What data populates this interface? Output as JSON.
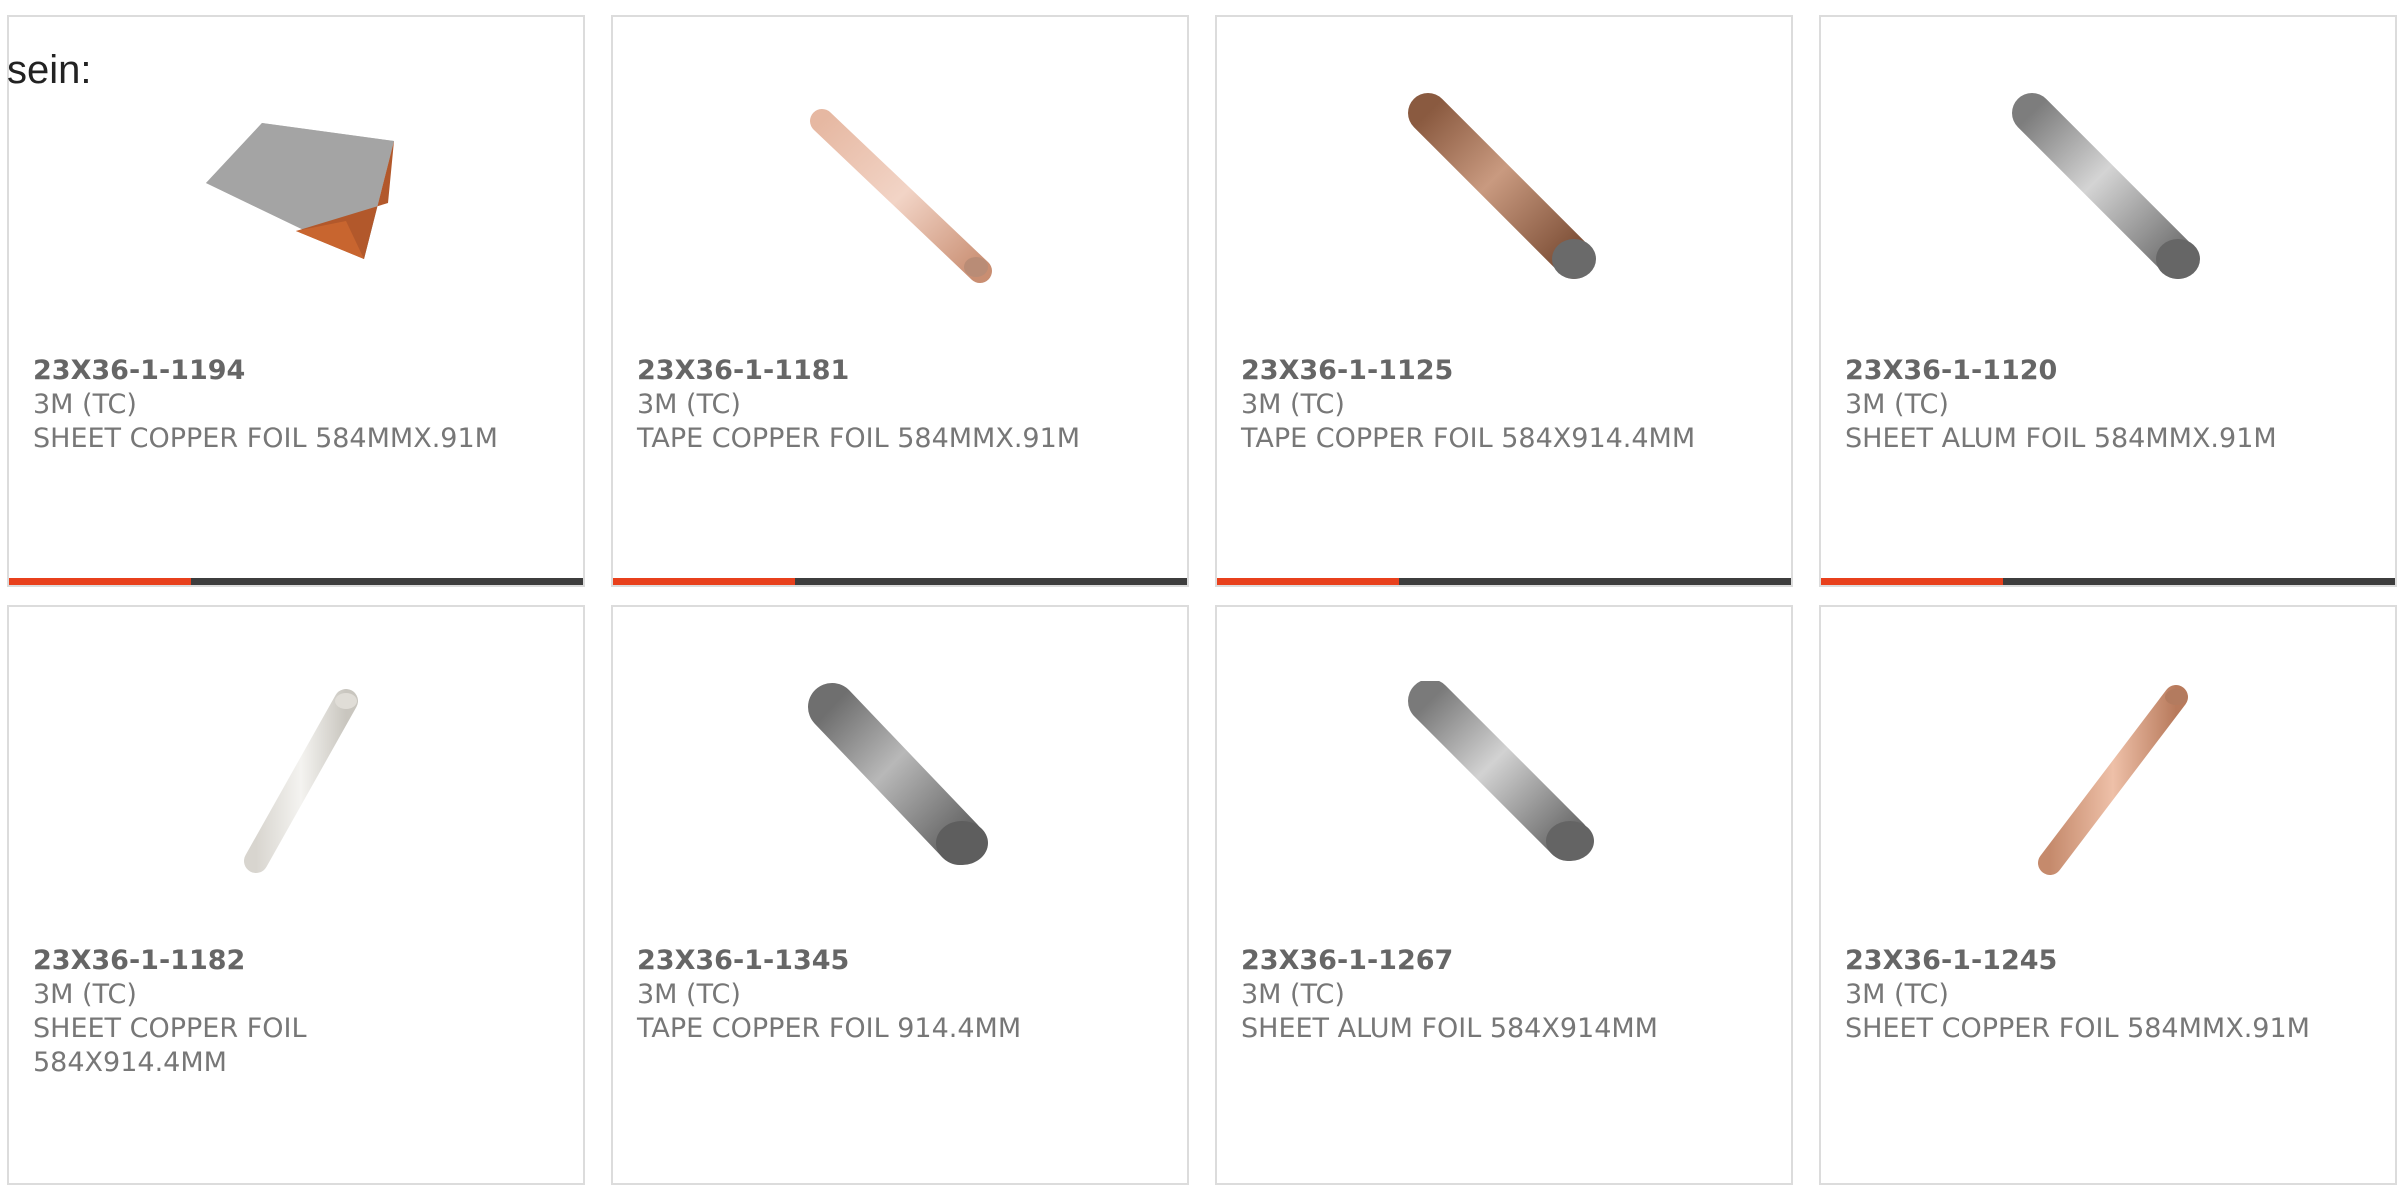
{
  "intro_text": "sein:",
  "products": [
    {
      "part_number": "23X36-1-1194",
      "manufacturer": "3M (TC)",
      "description": "SHEET COPPER FOIL 584MMX.91M",
      "image": "copper-sheet-image"
    },
    {
      "part_number": "23X36-1-1181",
      "manufacturer": "3M (TC)",
      "description": "TAPE COPPER FOIL 584MMX.91M",
      "image": "copper-roll-image"
    },
    {
      "part_number": "23X36-1-1125",
      "manufacturer": "3M (TC)",
      "description": "TAPE COPPER FOIL 584X914.4MM",
      "image": "copper-roll-image"
    },
    {
      "part_number": "23X36-1-1120",
      "manufacturer": "3M (TC)",
      "description": "SHEET ALUM FOIL 584MMX.91M",
      "image": "aluminum-roll-image"
    },
    {
      "part_number": "23X36-1-1182",
      "manufacturer": "3M (TC)",
      "description": "SHEET COPPER FOIL 584X914.4MM",
      "image": "clear-roll-image"
    },
    {
      "part_number": "23X36-1-1345",
      "manufacturer": "3M (TC)",
      "description": "TAPE COPPER FOIL 914.4MM",
      "image": "aluminum-roll-image"
    },
    {
      "part_number": "23X36-1-1267",
      "manufacturer": "3M (TC)",
      "description": "SHEET ALUM FOIL 584X914MM",
      "image": "aluminum-roll-image"
    },
    {
      "part_number": "23X36-1-1245",
      "manufacturer": "3M (TC)",
      "description": "SHEET COPPER FOIL 584MMX.91M",
      "image": "copper-roll-image"
    }
  ],
  "colors": {
    "accent": "#e8401c",
    "bar": "#3d3d3d",
    "border": "#dcdcdc"
  }
}
